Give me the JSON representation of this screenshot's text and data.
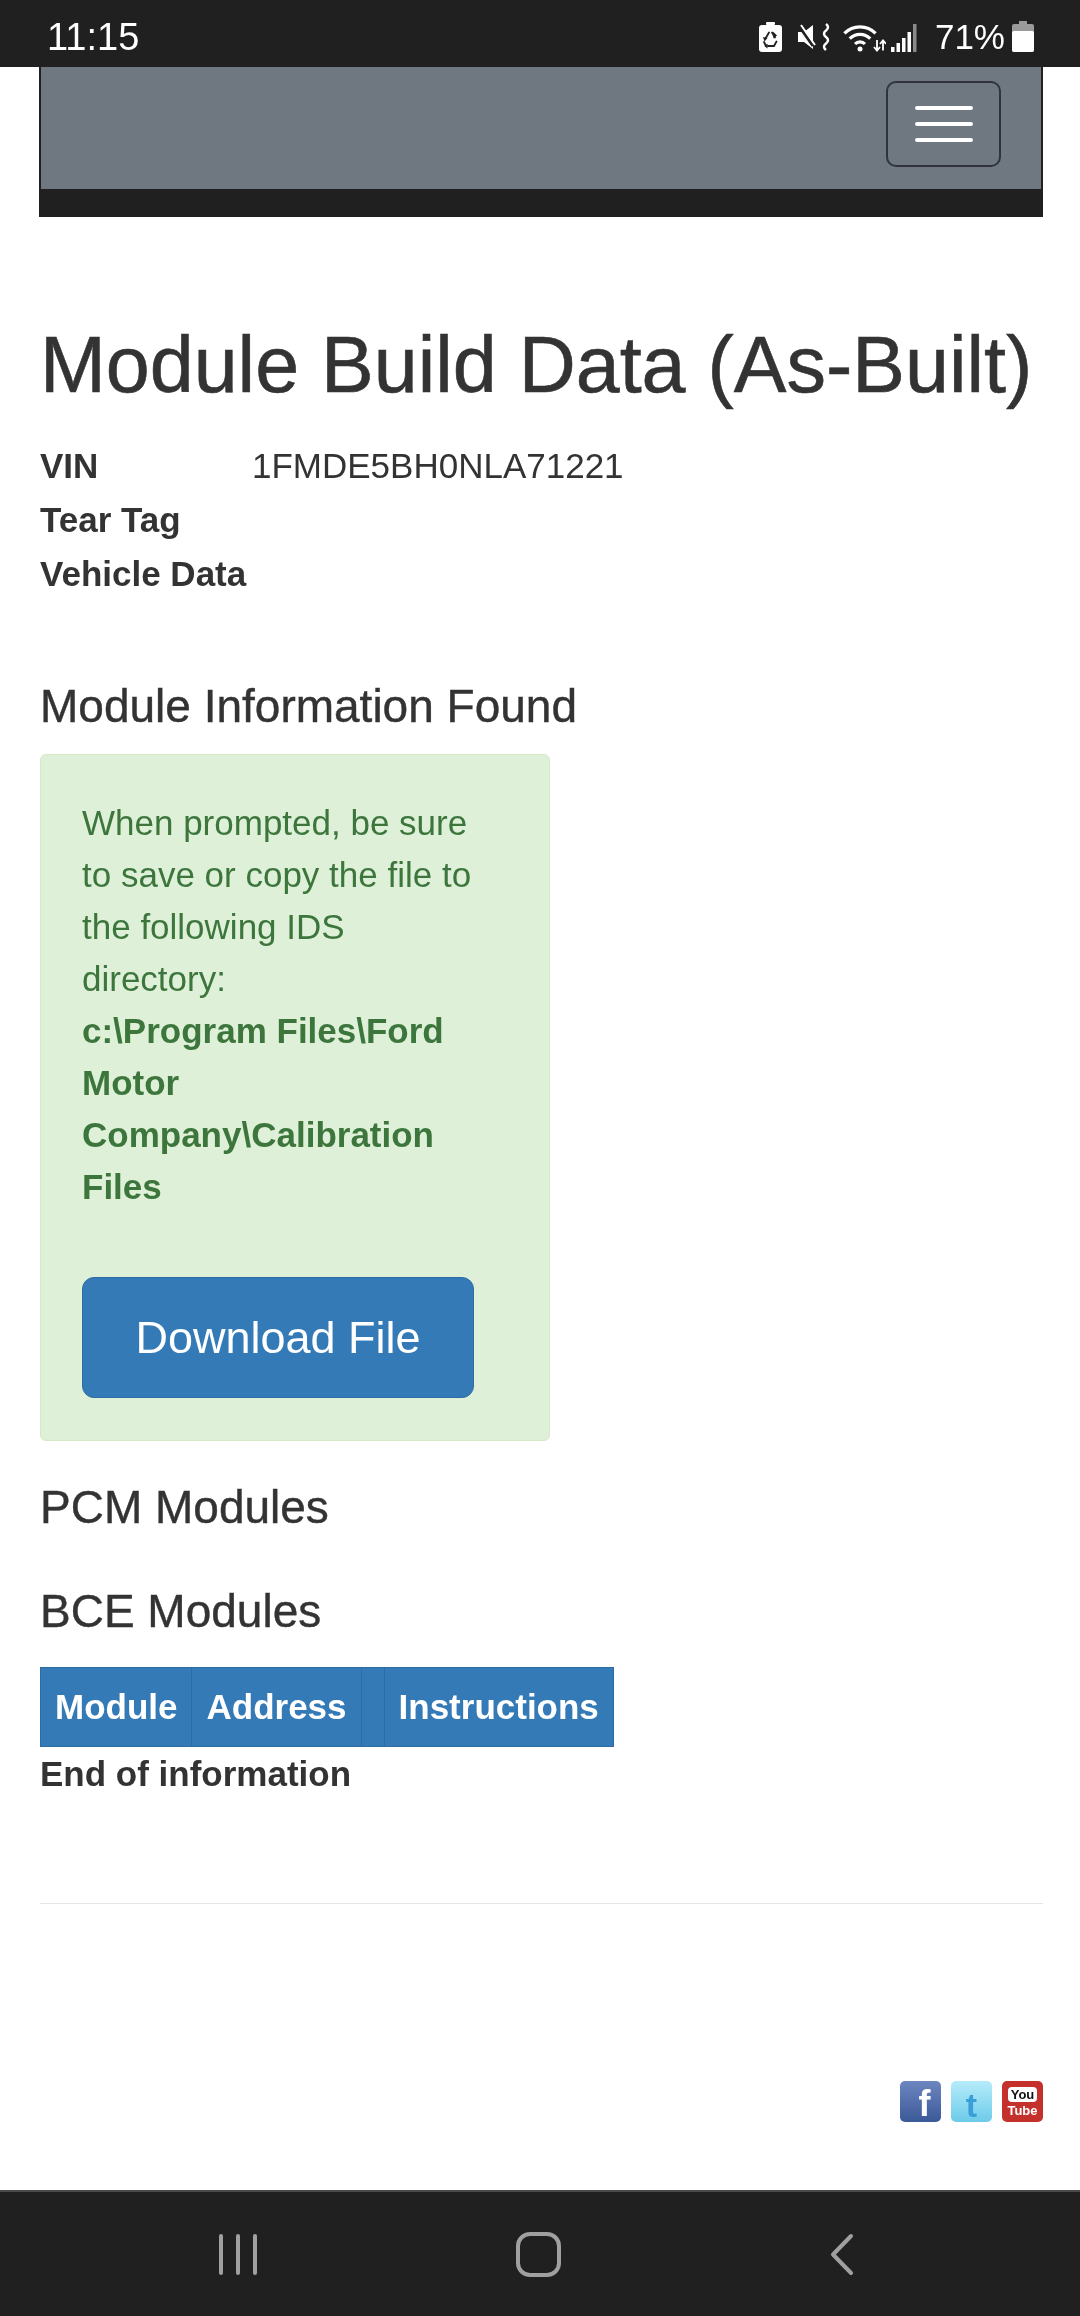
{
  "status_bar": {
    "time": "11:15",
    "battery": "71%"
  },
  "title": "Module Build Data (As-Built)",
  "vehicle_info": [
    {
      "label": "VIN",
      "value": "1FMDE5BH0NLA71221"
    },
    {
      "label": "Tear Tag"
    },
    {
      "label": "Vehicle Data"
    }
  ],
  "module_info": {
    "heading": "Module Information Found",
    "alert": {
      "message": "When prompted, be sure to save or copy the file to the following IDS directory:",
      "path": "c:\\Program Files\\Ford Motor Company\\Calibration Files",
      "button": "Download File"
    }
  },
  "sections": [
    {
      "heading": "PCM Modules"
    },
    {
      "heading": "BCE Modules",
      "table": {
        "columns": [
          {
            "label": "Module"
          },
          {
            "label": "Address"
          },
          {},
          {
            "label": "Instructions"
          }
        ]
      }
    }
  ],
  "end_note": "End of information",
  "footer": {
    "social_links": [
      {
        "kind": "facebook",
        "lines": [
          "f"
        ]
      },
      {
        "kind": "twitter",
        "lines": [
          "t"
        ]
      },
      {
        "kind": "youtube",
        "lines": [
          "You",
          "Tube"
        ]
      }
    ]
  }
}
